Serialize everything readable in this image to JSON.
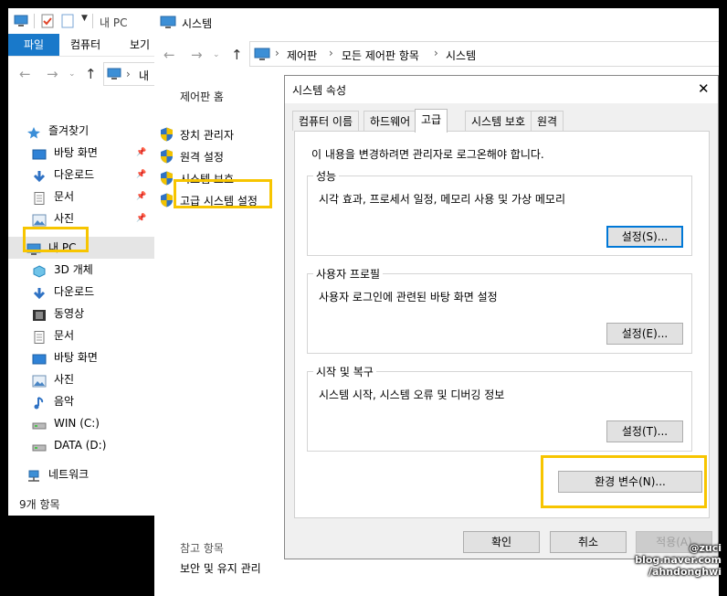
{
  "explorer": {
    "title": "내 PC",
    "ribbon_tabs": [
      "파일",
      "컴퓨터",
      "보기"
    ],
    "nav_crumb": "내",
    "tree": [
      {
        "label": "즐겨찾기",
        "icon": "star-icon",
        "pinned": false
      },
      {
        "label": "바탕 화면",
        "icon": "desktop-icon",
        "pinned": true
      },
      {
        "label": "다운로드",
        "icon": "download-icon",
        "pinned": true
      },
      {
        "label": "문서",
        "icon": "document-icon",
        "pinned": true
      },
      {
        "label": "사진",
        "icon": "pictures-icon",
        "pinned": true
      },
      {
        "label": "내 PC",
        "icon": "computer-icon",
        "pinned": false
      },
      {
        "label": "3D 개체",
        "icon": "cube-icon",
        "pinned": false
      },
      {
        "label": "다운로드",
        "icon": "download-icon",
        "pinned": false
      },
      {
        "label": "동영상",
        "icon": "video-icon",
        "pinned": false
      },
      {
        "label": "문서",
        "icon": "document-icon",
        "pinned": false
      },
      {
        "label": "바탕 화면",
        "icon": "desktop-icon",
        "pinned": false
      },
      {
        "label": "사진",
        "icon": "pictures-icon",
        "pinned": false
      },
      {
        "label": "음악",
        "icon": "music-icon",
        "pinned": false
      },
      {
        "label": "WIN (C:)",
        "icon": "drive-icon",
        "pinned": false
      },
      {
        "label": "DATA (D:)",
        "icon": "drive-icon",
        "pinned": false
      },
      {
        "label": "네트워크",
        "icon": "network-icon",
        "pinned": false
      }
    ],
    "status": "9개 항목"
  },
  "system": {
    "title": "시스템",
    "breadcrumb": [
      "제어판",
      "모든 제어판 항목",
      "시스템"
    ],
    "left": {
      "home": "제어판 홈",
      "links": [
        "장치 관리자",
        "원격 설정",
        "시스템 보호",
        "고급 시스템 설정"
      ],
      "see_also": "참고 항목",
      "security": "보안 및 유지 관리"
    }
  },
  "dialog": {
    "title": "시스템 속성",
    "close": "✕",
    "tabs": [
      "컴퓨터 이름",
      "하드웨어",
      "고급",
      "시스템 보호",
      "원격"
    ],
    "admin_note": "이 내용을 변경하려면 관리자로 로그온해야 합니다.",
    "performance": {
      "title": "성능",
      "desc": "시각 효과, 프로세서 일정, 메모리 사용 및 가상 메모리",
      "button": "설정(S)..."
    },
    "profile": {
      "title": "사용자 프로필",
      "desc": "사용자 로그인에 관련된 바탕 화면 설정",
      "button": "설정(E)..."
    },
    "startup": {
      "title": "시작 및 복구",
      "desc": "시스템 시작, 시스템 오류 및 디버깅 정보",
      "button": "설정(T)..."
    },
    "env_button": "환경 변수(N)...",
    "ok": "확인",
    "cancel": "취소",
    "apply": "적용(A)"
  },
  "watermark": [
    "@zuci",
    "blog.naver.com",
    "/ahndonghwi"
  ]
}
